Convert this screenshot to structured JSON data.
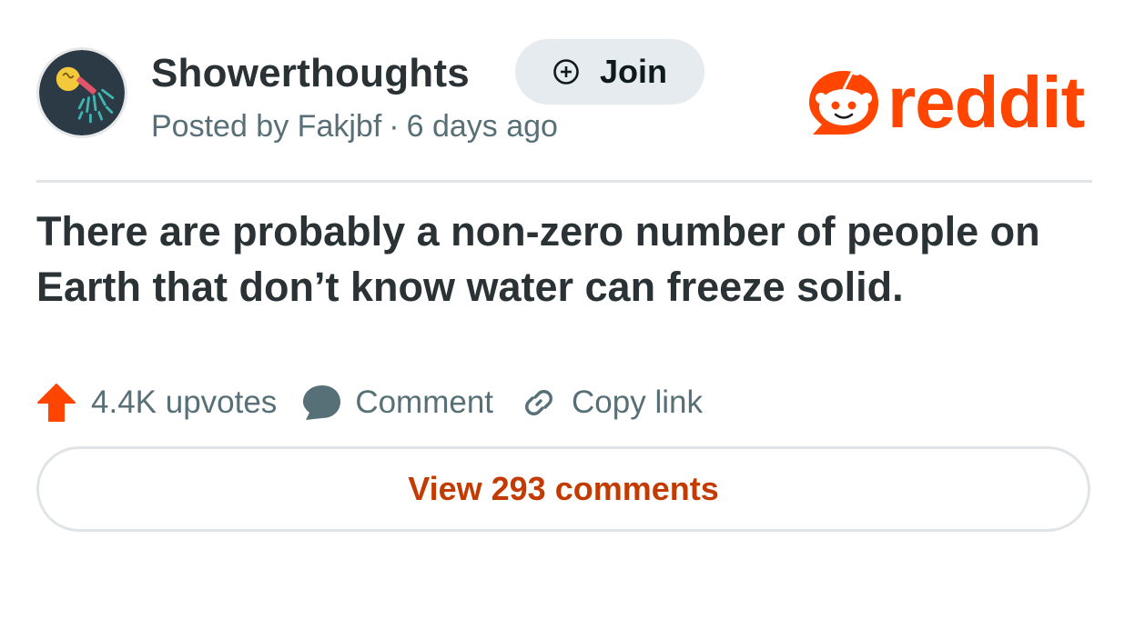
{
  "post": {
    "subreddit": "Showerthoughts",
    "posted_prefix": "Posted by",
    "author": "Fakjbf",
    "separator": "·",
    "time_ago": "6 days ago",
    "title": "There are probably a non-zero number of people on Earth that don’t know water can freeze solid."
  },
  "join_label": "Join",
  "logo_text": "reddit",
  "actions": {
    "upvotes": "4.4K upvotes",
    "comment": "Comment",
    "copy_link": "Copy link"
  },
  "view_comments": "View 293 comments",
  "colors": {
    "brand": "#ff4500",
    "link": "#c33b00",
    "text": "#2a3236",
    "muted": "#576f76"
  },
  "icons": [
    "subreddit-avatar-icon",
    "add-circle-icon",
    "reddit-snoo-icon",
    "upvote-arrow-icon",
    "comment-bubble-icon",
    "link-chain-icon"
  ]
}
